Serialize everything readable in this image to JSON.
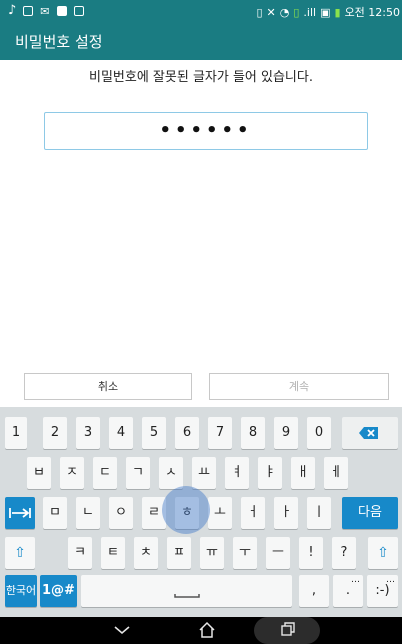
{
  "status_bar": {
    "time": "오전 12:50",
    "signal_label": ".ill"
  },
  "app_bar": {
    "title": "비밀번호 설정"
  },
  "message": "비밀번호에 잘못된 글자가 들어 있습니다.",
  "password_field": {
    "value": "••••••"
  },
  "buttons": {
    "cancel": "취소",
    "next": "계속"
  },
  "keyboard": {
    "row1": [
      "1",
      "2",
      "3",
      "4",
      "5",
      "6",
      "7",
      "8",
      "9",
      "0"
    ],
    "row2": [
      "ㅂ",
      "ㅈ",
      "ㄷ",
      "ㄱ",
      "ㅅ",
      "ㅛ",
      "ㅕ",
      "ㅑ",
      "ㅐ",
      "ㅔ"
    ],
    "row3": [
      "ㅁ",
      "ㄴ",
      "ㅇ",
      "ㄹ",
      "ㅎ",
      "ㅗ",
      "ㅓ",
      "ㅏ",
      "ㅣ"
    ],
    "row4": [
      "ㅋ",
      "ㅌ",
      "ㅊ",
      "ㅍ",
      "ㅠ",
      "ㅜ",
      "ㅡ",
      "!",
      "?"
    ],
    "lang": "한국어",
    "symbols": "1@#",
    "comma": ",",
    "period": ".",
    "emoticon": ":-)",
    "enter": "다음",
    "ellipsis": "…"
  },
  "colors": {
    "primary": "#1a7c82",
    "accent": "#1789c9"
  }
}
